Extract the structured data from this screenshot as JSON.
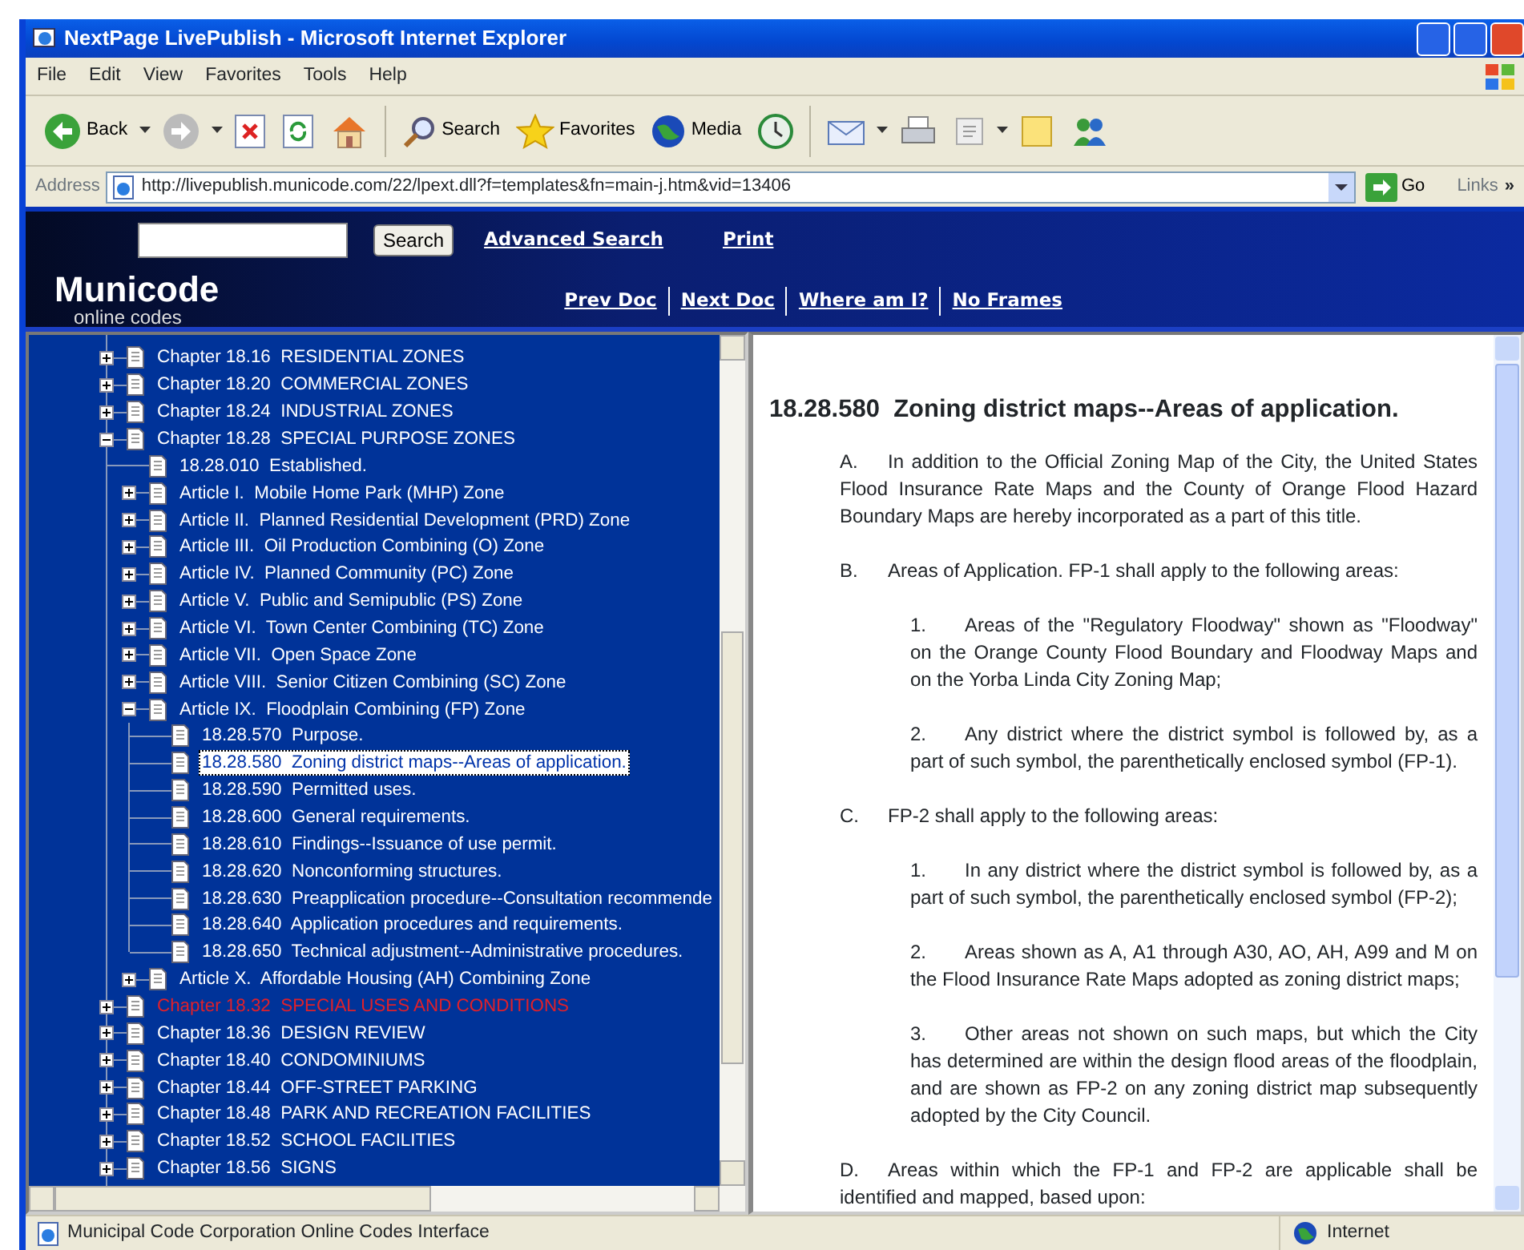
{
  "window": {
    "title": "NextPage LivePublish - Microsoft Internet Explorer"
  },
  "menu": [
    "File",
    "Edit",
    "View",
    "Favorites",
    "Tools",
    "Help"
  ],
  "toolbar": {
    "back": {
      "label": "Back",
      "dropdown": true
    },
    "search": {
      "label": "Search"
    },
    "favorites": {
      "label": "Favorites"
    },
    "media": {
      "label": "Media"
    }
  },
  "address": {
    "label": "Address",
    "url": "http://livepublish.municode.com/22/lpext.dll?f=templates&fn=main-j.htm&vid=13406",
    "go": "Go",
    "links": "Links",
    "more": "»"
  },
  "site_header": {
    "search_button": "Search",
    "top_links": [
      "Advanced Search",
      "Print"
    ],
    "logo": {
      "name": "Municode",
      "tagline": "online codes"
    },
    "nav_links": [
      "Prev Doc",
      "Next Doc",
      "Where am I?",
      "No Frames"
    ]
  },
  "tree": [
    {
      "label": "Chapter 18.16  RESIDENTIAL ZONES",
      "expanded": false,
      "selected": false,
      "highlighted": false
    },
    {
      "label": "Chapter 18.20  COMMERCIAL ZONES",
      "expanded": false,
      "selected": false,
      "highlighted": false
    },
    {
      "label": "Chapter 18.24  INDUSTRIAL ZONES",
      "expanded": false,
      "selected": false,
      "highlighted": false
    },
    {
      "label": "Chapter 18.28  SPECIAL PURPOSE ZONES",
      "expanded": true,
      "selected": false,
      "highlighted": false,
      "children": [
        {
          "label": "18.28.010  Established.",
          "selected": false,
          "highlighted": false
        },
        {
          "label": "Article I.  Mobile Home Park (MHP) Zone",
          "expanded": false,
          "selected": false,
          "highlighted": false
        },
        {
          "label": "Article II.  Planned Residential Development (PRD) Zone",
          "expanded": false,
          "selected": false,
          "highlighted": false
        },
        {
          "label": "Article III.  Oil Production Combining (O) Zone",
          "expanded": false,
          "selected": false,
          "highlighted": false
        },
        {
          "label": "Article IV.  Planned Community (PC) Zone",
          "expanded": false,
          "selected": false,
          "highlighted": false
        },
        {
          "label": "Article V.  Public and Semipublic (PS) Zone",
          "expanded": false,
          "selected": false,
          "highlighted": false
        },
        {
          "label": "Article VI.  Town Center Combining (TC) Zone",
          "expanded": false,
          "selected": false,
          "highlighted": false
        },
        {
          "label": "Article VII.  Open Space Zone",
          "expanded": false,
          "selected": false,
          "highlighted": false
        },
        {
          "label": "Article VIII.  Senior Citizen Combining (SC) Zone",
          "expanded": false,
          "selected": false,
          "highlighted": false
        },
        {
          "label": "Article IX.  Floodplain Combining (FP) Zone",
          "expanded": true,
          "selected": false,
          "highlighted": false,
          "children": [
            {
              "label": "18.28.570  Purpose.",
              "selected": false,
              "highlighted": false
            },
            {
              "label": "18.28.580  Zoning district maps--Areas of application.",
              "selected": true,
              "highlighted": false
            },
            {
              "label": "18.28.590  Permitted uses.",
              "selected": false,
              "highlighted": false
            },
            {
              "label": "18.28.600  General requirements.",
              "selected": false,
              "highlighted": false
            },
            {
              "label": "18.28.610  Findings--Issuance of use permit.",
              "selected": false,
              "highlighted": false
            },
            {
              "label": "18.28.620  Nonconforming structures.",
              "selected": false,
              "highlighted": false
            },
            {
              "label": "18.28.630  Preapplication procedure--Consultation recommende",
              "selected": false,
              "highlighted": false
            },
            {
              "label": "18.28.640  Application procedures and requirements.",
              "selected": false,
              "highlighted": false
            },
            {
              "label": "18.28.650  Technical adjustment--Administrative procedures.",
              "selected": false,
              "highlighted": false
            }
          ]
        },
        {
          "label": "Article X.  Affordable Housing (AH) Combining Zone",
          "expanded": false,
          "selected": false,
          "highlighted": false
        }
      ]
    },
    {
      "label": "Chapter 18.32  SPECIAL USES AND CONDITIONS",
      "expanded": false,
      "selected": false,
      "highlighted": true
    },
    {
      "label": "Chapter 18.36  DESIGN REVIEW",
      "expanded": false,
      "selected": false,
      "highlighted": false
    },
    {
      "label": "Chapter 18.40  CONDOMINIUMS",
      "expanded": false,
      "selected": false,
      "highlighted": false
    },
    {
      "label": "Chapter 18.44  OFF-STREET PARKING",
      "expanded": false,
      "selected": false,
      "highlighted": false
    },
    {
      "label": "Chapter 18.48  PARK AND RECREATION FACILITIES",
      "expanded": false,
      "selected": false,
      "highlighted": false
    },
    {
      "label": "Chapter 18.52  SCHOOL FACILITIES",
      "expanded": false,
      "selected": false,
      "highlighted": false
    },
    {
      "label": "Chapter 18.56  SIGNS",
      "expanded": false,
      "selected": false,
      "highlighted": false
    }
  ],
  "document": {
    "heading": "18.28.580  Zoning district maps--Areas of application.",
    "sections": [
      {
        "marker": "A.",
        "text": "In addition to the Official Zoning Map of the City, the United States Flood Insurance Rate Maps and the County of Orange Flood Hazard Boundary Maps are hereby incorporated as a part of this title."
      },
      {
        "marker": "B.",
        "text": "Areas of Application. FP-1 shall apply to the following areas:",
        "items": [
          {
            "marker": "1.",
            "text": "Areas of the \"Regulatory Floodway\" shown as \"Floodway\" on the Orange County Flood Boundary and Floodway Maps and on the Yorba Linda City Zoning Map;"
          },
          {
            "marker": "2.",
            "text": "Any district where the district symbol is followed by, as a part of such symbol, the parenthetically enclosed symbol (FP-1)."
          }
        ]
      },
      {
        "marker": "C.",
        "text": "FP-2 shall apply to the following areas:",
        "items": [
          {
            "marker": "1.",
            "text": "In any district where the district symbol is followed by, as a part of such symbol, the parenthetically enclosed symbol (FP-2);"
          },
          {
            "marker": "2.",
            "text": "Areas shown as A, A1 through A30, AO, AH, A99 and M on the Flood Insurance Rate Maps adopted as zoning district maps;"
          },
          {
            "marker": "3.",
            "text": "Other areas not shown on such maps, but which the City has determined are within the design flood areas of the floodplain, and are shown as FP-2 on any zoning district map subsequently adopted by the City Council."
          }
        ]
      },
      {
        "marker": "D.",
        "text": "Areas within which the FP-1 and FP-2 are applicable shall be identified and mapped, based upon:"
      }
    ]
  },
  "status_bar": {
    "text": "Municipal Code Corporation Online Codes Interface",
    "zone": "Internet"
  }
}
